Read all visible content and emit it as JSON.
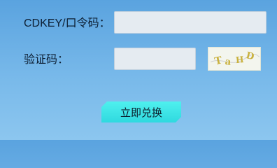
{
  "form": {
    "cdkey_label": "CDKEY/口令码：",
    "cdkey_value": "",
    "captcha_label": "验证码：",
    "captcha_value": "",
    "captcha_image_text": "TaHD",
    "submit_label": "立即兑换"
  },
  "colors": {
    "background_top": "#5aa3df",
    "background_bottom": "#8cc6ef",
    "input_background": "#e5ebf1",
    "button_accent": "#2fd9df",
    "captcha_text": "#c9b13d"
  }
}
